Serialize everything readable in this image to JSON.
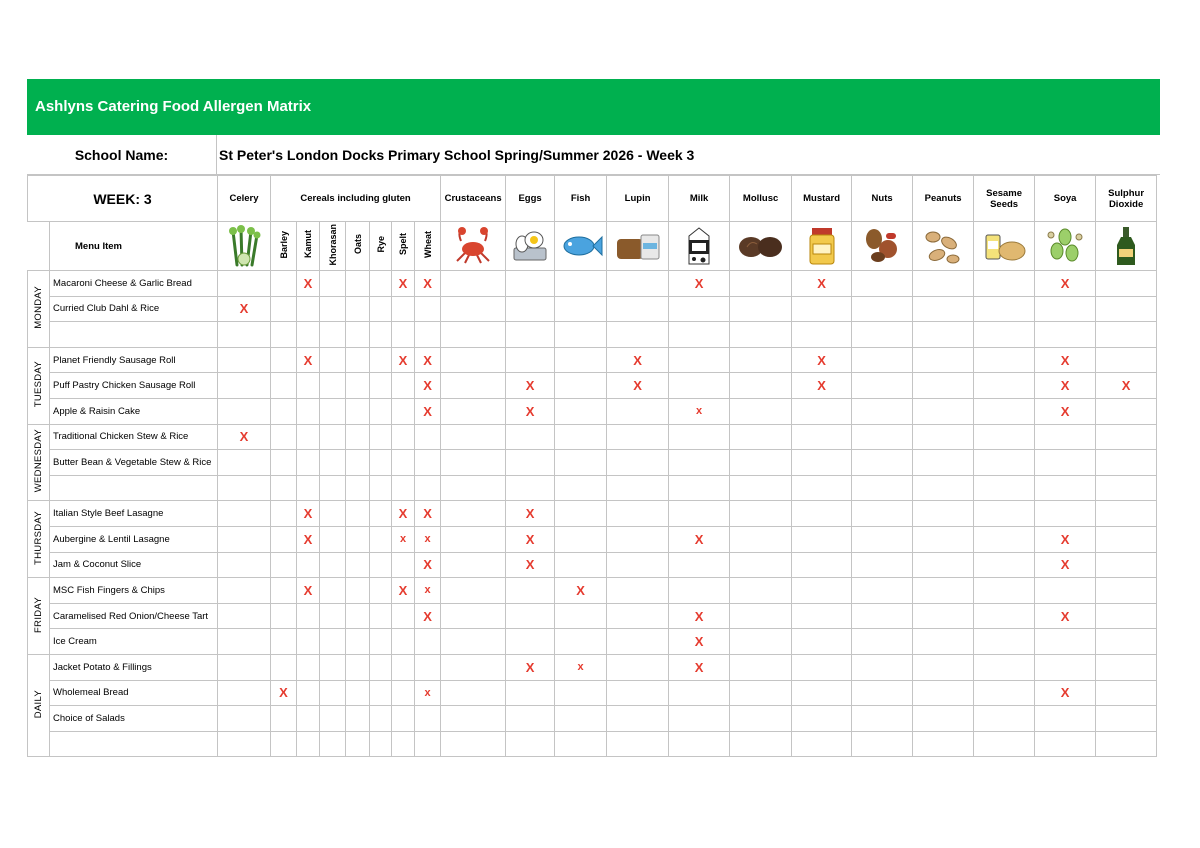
{
  "title": "Ashlyns Catering Food Allergen Matrix",
  "school_label": "School Name:",
  "school_name": "St Peter's London Docks Primary School Spring/Summer 2026 - Week 3",
  "week_label": "WEEK: 3",
  "menu_item_label": "Menu Item",
  "allergens": {
    "celery": "Celery",
    "cereals": "Cereals including gluten",
    "crustaceans": "Crustaceans",
    "eggs": "Eggs",
    "fish": "Fish",
    "lupin": "Lupin",
    "milk": "Milk",
    "mollusc": "Mollusc",
    "mustard": "Mustard",
    "nuts": "Nuts",
    "peanuts": "Peanuts",
    "sesame": "Sesame Seeds",
    "soya": "Soya",
    "sulphur": "Sulphur Dioxide"
  },
  "cereals": [
    "Barley",
    "Kamut",
    "Khorasan",
    "Oats",
    "Rye",
    "Spelt",
    "Wheat"
  ],
  "icons": [
    "celery-icon",
    "crab-icon",
    "eggs-icon",
    "fish-icon",
    "bread-icon",
    "milk-carton-icon",
    "mollusc-icon",
    "mustard-jar-icon",
    "nuts-icon",
    "peanuts-icon",
    "sesame-bread-icon",
    "soya-beans-icon",
    "bottle-icon"
  ],
  "colors": {
    "banner": "#00b04f",
    "mark": "#e53b2f",
    "grid": "#c4c4c4"
  },
  "mark": "X",
  "mark_lower": "x",
  "days": [
    {
      "day": "MONDAY",
      "items": [
        {
          "name": "Macaroni Cheese & Garlic Bread",
          "m": {
            "kamut": "X",
            "spelt": "X",
            "wheat": "X",
            "milk": "X",
            "mustard": "X",
            "soya": "X"
          }
        },
        {
          "name": "Curried Club Dahl & Rice",
          "m": {
            "celery": "X"
          }
        },
        {
          "name": "",
          "m": {}
        }
      ]
    },
    {
      "day": "TUESDAY",
      "items": [
        {
          "name": "Planet Friendly Sausage Roll",
          "m": {
            "kamut": "X",
            "spelt": "X",
            "wheat": "X",
            "lupin": "X",
            "mustard": "X",
            "soya": "X"
          }
        },
        {
          "name": "Puff Pastry Chicken Sausage Roll",
          "m": {
            "wheat": "X",
            "eggs": "X",
            "lupin": "X",
            "mustard": "X",
            "soya": "X",
            "sulphur": "X"
          }
        },
        {
          "name": "Apple & Raisin Cake",
          "m": {
            "wheat": "X",
            "eggs": "X",
            "milk": "x",
            "soya": "X"
          }
        }
      ]
    },
    {
      "day": "WEDNESDAY",
      "items": [
        {
          "name": "Traditional Chicken Stew & Rice",
          "m": {
            "celery": "X"
          }
        },
        {
          "name": "Butter Bean & Vegetable Stew & Rice",
          "m": {}
        },
        {
          "name": "",
          "m": {}
        }
      ]
    },
    {
      "day": "THURSDAY",
      "items": [
        {
          "name": "Italian Style Beef Lasagne",
          "m": {
            "kamut": "X",
            "spelt": "X",
            "wheat": "X",
            "eggs": "X"
          }
        },
        {
          "name": "Aubergine & Lentil Lasagne",
          "m": {
            "kamut": "X",
            "spelt": "x",
            "wheat": "x",
            "eggs": "X",
            "milk": "X",
            "soya": "X"
          }
        },
        {
          "name": "Jam & Coconut Slice",
          "m": {
            "wheat": "X",
            "eggs": "X",
            "soya": "X"
          }
        }
      ]
    },
    {
      "day": "FRIDAY",
      "items": [
        {
          "name": "MSC Fish Fingers & Chips",
          "m": {
            "kamut": "X",
            "spelt": "X",
            "wheat": "x",
            "fish": "X"
          }
        },
        {
          "name": "Caramelised Red Onion/Cheese Tart",
          "m": {
            "wheat": "X",
            "milk": "X",
            "soya": "X"
          }
        },
        {
          "name": "Ice Cream",
          "m": {
            "milk": "X"
          }
        }
      ]
    },
    {
      "day": "DAILY",
      "items": [
        {
          "name": "Jacket Potato & Fillings",
          "m": {
            "eggs": "X",
            "fish": "x",
            "milk": "X"
          }
        },
        {
          "name": "Wholemeal Bread",
          "m": {
            "barley": "X",
            "wheat": "x",
            "soya": "X"
          }
        },
        {
          "name": "Choice of Salads",
          "m": {}
        },
        {
          "name": "",
          "m": {}
        }
      ]
    }
  ]
}
